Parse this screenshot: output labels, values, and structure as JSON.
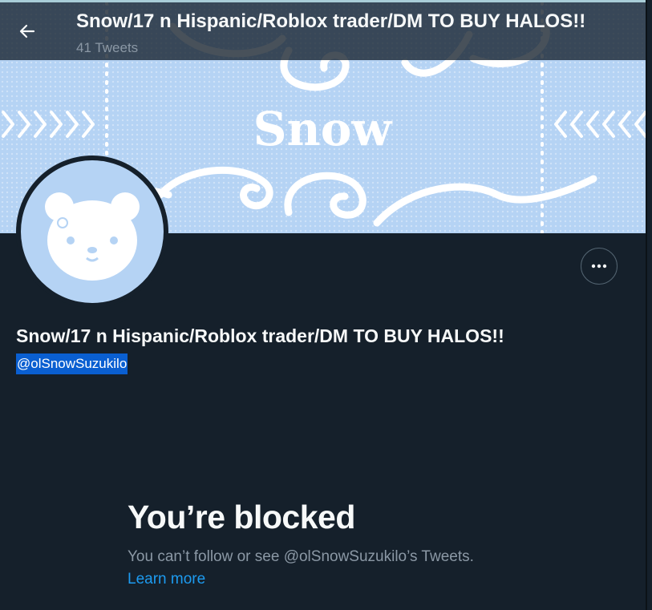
{
  "header": {
    "title": "Snow/17 n Hispanic/Roblox trader/DM TO BUY HALOS!!",
    "tweet_count": "41 Tweets",
    "back_icon": "arrow-left-icon"
  },
  "banner": {
    "text": "Snow"
  },
  "profile": {
    "display_name": "Snow/17 n Hispanic/Roblox trader/DM TO BUY HALOS!!",
    "handle": "@olSnowSuzukilo",
    "more_icon": "more-horizontal-icon"
  },
  "blocked": {
    "title": "You’re blocked",
    "message": "You can’t follow or see @olSnowSuzukilo’s Tweets.",
    "learn_more": "Learn more"
  },
  "colors": {
    "background": "#15202b",
    "banner": "#b5d3f4",
    "link": "#1d9bf0",
    "secondary_text": "#8b98a5",
    "selection": "#0a5fd1"
  }
}
